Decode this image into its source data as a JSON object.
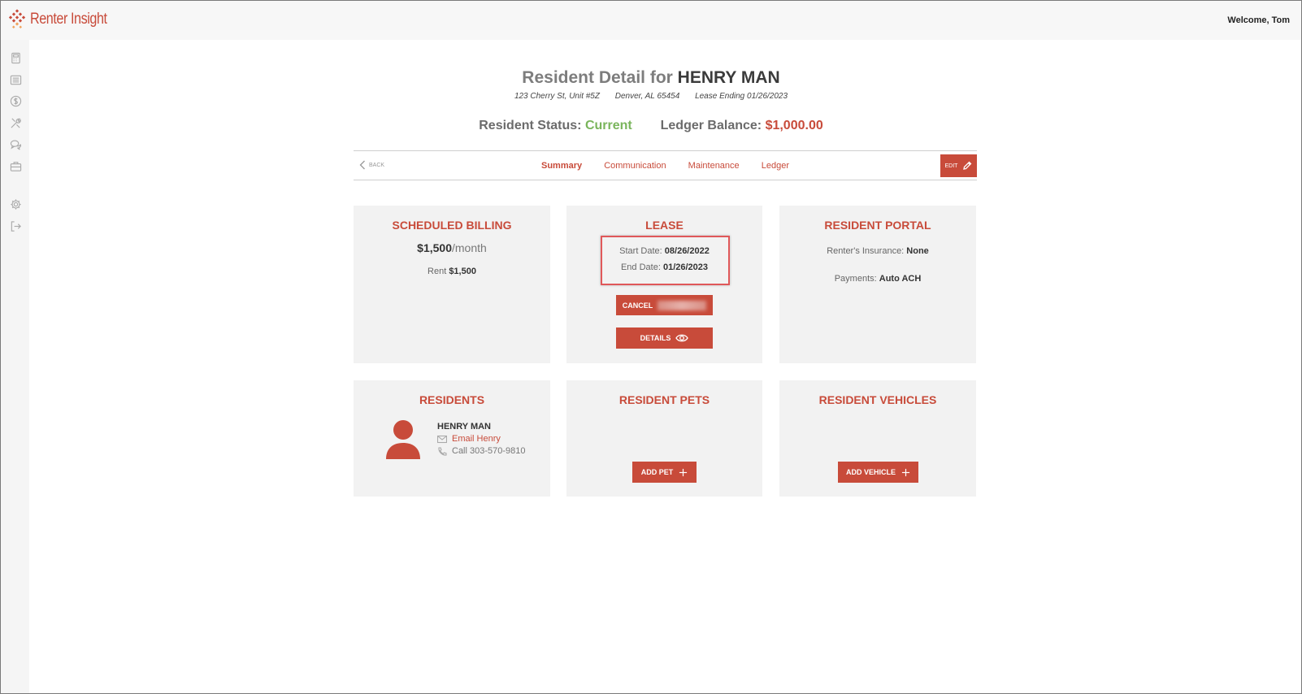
{
  "app": {
    "name": "Renter Insight",
    "welcome": "Welcome, Tom"
  },
  "sidebar": {
    "icons": [
      "calculator-icon",
      "list-icon",
      "dollar-icon",
      "tools-icon",
      "chat-icon",
      "briefcase-icon",
      "gear-icon",
      "logout-icon"
    ]
  },
  "header": {
    "title_prefix": "Resident Detail for ",
    "resident_name": "HENRY MAN",
    "address": "123 Cherry St, Unit #5Z",
    "city": "Denver, AL 65454",
    "lease_ending": "Lease Ending 01/26/2023",
    "status_label": "Resident Status: ",
    "status_value": "Current",
    "balance_label": "Ledger Balance: ",
    "balance_value": "$1,000.00"
  },
  "nav": {
    "back": "BACK",
    "tabs": [
      "Summary",
      "Communication",
      "Maintenance",
      "Ledger"
    ],
    "active_tab": "Summary",
    "edit": "EDIT"
  },
  "billing": {
    "title": "SCHEDULED BILLING",
    "amount": "$1,500",
    "unit": "/month",
    "rent_label": "Rent ",
    "rent_value": "$1,500"
  },
  "lease": {
    "title": "LEASE",
    "start_label": "Start Date: ",
    "start_value": "08/26/2022",
    "end_label": "End Date: ",
    "end_value": "01/26/2023",
    "cancel": "CANCEL",
    "details": "DETAILS"
  },
  "portal": {
    "title": "RESIDENT PORTAL",
    "insurance_label": "Renter's Insurance: ",
    "insurance_value": "None",
    "payments_label": "Payments: ",
    "payments_value": "Auto ACH"
  },
  "residents": {
    "title": "RESIDENTS",
    "name": "HENRY MAN",
    "email": "Email Henry",
    "call": "Call 303-570-9810"
  },
  "pets": {
    "title": "RESIDENT PETS",
    "add": "ADD PET"
  },
  "vehicles": {
    "title": "RESIDENT VEHICLES",
    "add": "ADD VEHICLE"
  },
  "colors": {
    "accent": "#c84b3a",
    "status_green": "#7ab55c",
    "card_bg": "#f2f2f2"
  }
}
